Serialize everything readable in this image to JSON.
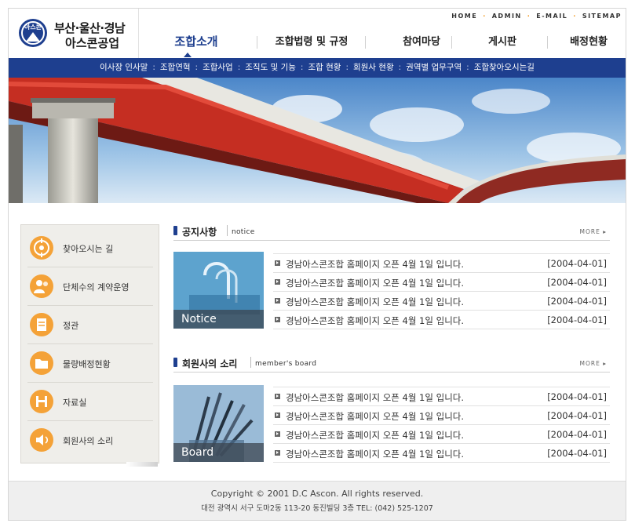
{
  "logo": {
    "mark_text": "아스콘",
    "line1": "부산·울산·경남",
    "line2": "아스콘공업"
  },
  "utility_links": [
    "HOME",
    "ADMIN",
    "E-MAIL",
    "SITEMAP"
  ],
  "gnb": [
    {
      "label": "조합소개",
      "active": true
    },
    {
      "label": "조합법령 및 규정",
      "active": false
    },
    {
      "label": "참여마당",
      "active": false
    },
    {
      "label": "게시판",
      "active": false
    },
    {
      "label": "배정현황",
      "active": false
    }
  ],
  "subnav": [
    "이사장 인사말",
    "조합연혁",
    "조합사업",
    "조직도 및 기능",
    "조합 현황",
    "회원사 현황",
    "권역별 업무구역",
    "조합찾아오시는길"
  ],
  "sidebar": [
    {
      "label": "찾아오시는 길",
      "icon": "target-icon"
    },
    {
      "label": "단체수의 계약운영",
      "icon": "people-icon"
    },
    {
      "label": "정관",
      "icon": "document-icon"
    },
    {
      "label": "물량배정현황",
      "icon": "folder-icon"
    },
    {
      "label": "자료실",
      "icon": "disk-icon"
    },
    {
      "label": "회원사의 소리",
      "icon": "speaker-icon"
    }
  ],
  "notice": {
    "title": "공지사항",
    "title_en": "notice",
    "more": "MORE ▸",
    "image_caption": "Notice",
    "rows": [
      {
        "text": "경남아스콘조합 홈페이지 오픈 4월 1일 입니다.",
        "date": "[2004-04-01]"
      },
      {
        "text": "경남아스콘조합 홈페이지 오픈 4월 1일 입니다.",
        "date": "[2004-04-01]"
      },
      {
        "text": "경남아스콘조합 홈페이지 오픈 4월 1일 입니다.",
        "date": "[2004-04-01]"
      },
      {
        "text": "경남아스콘조합 홈페이지 오픈 4월 1일 입니다.",
        "date": "[2004-04-01]"
      }
    ]
  },
  "board": {
    "title": "회원사의 소리",
    "title_en": "member's board",
    "more": "MORE ▸",
    "image_caption": "Board",
    "rows": [
      {
        "text": "경남아스콘조합 홈페이지 오픈 4월 1일 입니다.",
        "date": "[2004-04-01]"
      },
      {
        "text": "경남아스콘조합 홈페이지 오픈 4월 1일 입니다.",
        "date": "[2004-04-01]"
      },
      {
        "text": "경남아스콘조합 홈페이지 오픈 4월 1일 입니다.",
        "date": "[2004-04-01]"
      },
      {
        "text": "경남아스콘조합 홈페이지 오픈 4월 1일 입니다.",
        "date": "[2004-04-01]"
      }
    ]
  },
  "footer": {
    "copyright": "Copyright © 2001 D.C Ascon. All rights reserved.",
    "address": "대전 광역시 서구 도마2동 113-20 동진빌딩 3층 TEL: (042) 525-1207"
  },
  "colors": {
    "brand_blue": "#1e3f8f",
    "accent_orange": "#f4a238",
    "bridge_red": "#d9352a"
  }
}
